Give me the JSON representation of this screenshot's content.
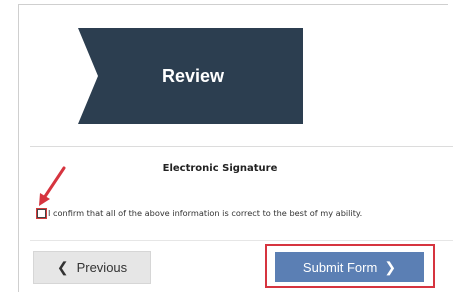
{
  "step": {
    "label": "Review",
    "fill_color": "#2c3e50"
  },
  "signature": {
    "title": "Electronic Signature",
    "checkbox_checked": false,
    "confirm_text": "I confirm that all of the above information is correct to the best of my ability."
  },
  "annotation": {
    "arrow_color": "#d6343f",
    "highlight_color": "#d6343f"
  },
  "buttons": {
    "previous_label": "Previous",
    "previous_icon": "chevron-left-icon",
    "submit_label": "Submit Form",
    "submit_icon": "chevron-right-icon",
    "submit_color": "#5b7fb4"
  }
}
